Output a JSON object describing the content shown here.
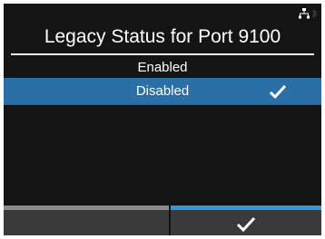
{
  "header": {
    "title": "Legacy Status for Port 9100",
    "icons": [
      "network-icon",
      "bluetooth-icon"
    ]
  },
  "options": [
    {
      "label": "Enabled",
      "selected": false
    },
    {
      "label": "Disabled",
      "selected": true
    }
  ],
  "softkeys": {
    "left": {
      "icon": "none",
      "accent": "#8a8a8a"
    },
    "right": {
      "icon": "check-icon",
      "accent": "#2f9ae0"
    }
  },
  "colors": {
    "background": "#141414",
    "selection": "#2a6fa6",
    "text": "#ffffff"
  }
}
